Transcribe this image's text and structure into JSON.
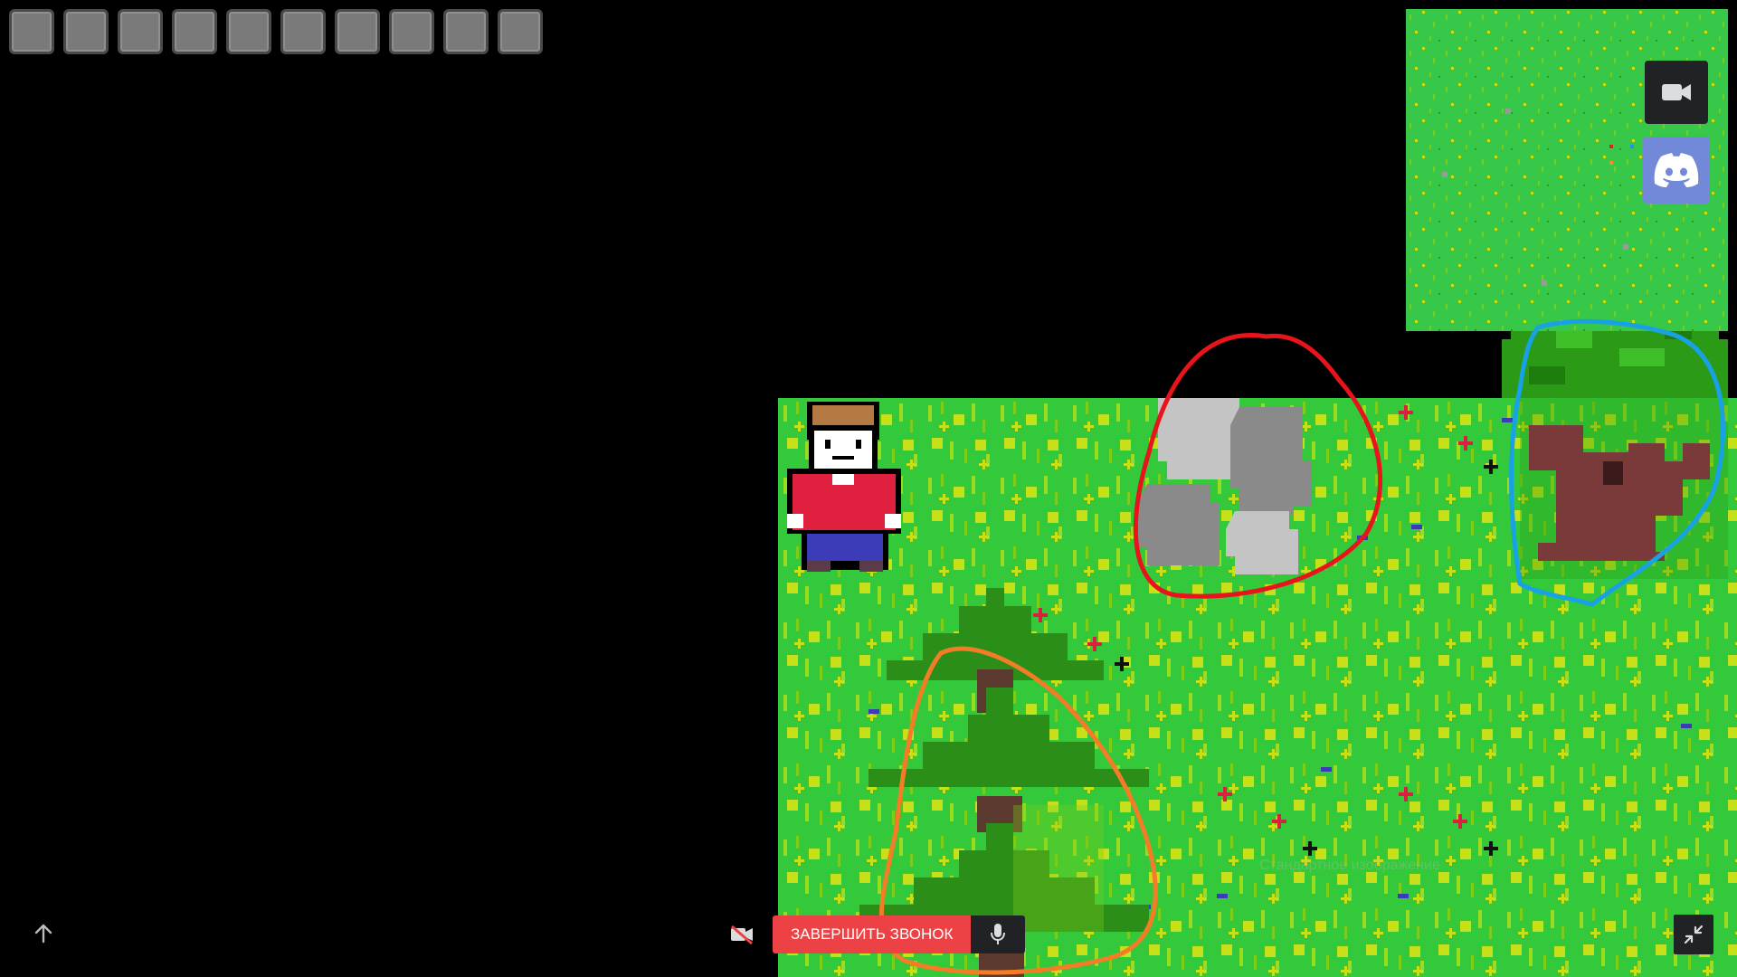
{
  "hotbar": {
    "slots": [
      {
        "state": "empty"
      },
      {
        "state": "empty"
      },
      {
        "state": "empty"
      },
      {
        "state": "empty"
      },
      {
        "state": "empty"
      },
      {
        "state": "empty"
      },
      {
        "state": "empty"
      },
      {
        "state": "empty"
      },
      {
        "state": "empty"
      },
      {
        "state": "empty"
      }
    ]
  },
  "world": {
    "player": "player-sprite",
    "objects": [
      "rock-cluster",
      "pine-tree",
      "oak-tree"
    ],
    "ground_color": "#33c93a"
  },
  "annotations": {
    "rocks_color": "#e8141c",
    "pine_color": "#f37d27",
    "oak_color": "#19a1e6"
  },
  "minimap": {
    "background": "#37c84a",
    "player_marker_color": "#e02020"
  },
  "side_buttons": {
    "camera_icon": "video-camera-icon",
    "discord_icon": "discord-icon",
    "discord_color": "#7289da"
  },
  "call": {
    "end_label": "ЗАВЕРШИТЬ ЗВОНОК",
    "end_color": "#ed4245",
    "camera_icon": "camera-off-icon",
    "mic_icon": "microphone-icon"
  },
  "controls": {
    "scroll_up_icon": "arrow-up-icon",
    "collapse_icon": "collapse-icon"
  },
  "caption": {
    "text": "Стандартное изображение"
  }
}
